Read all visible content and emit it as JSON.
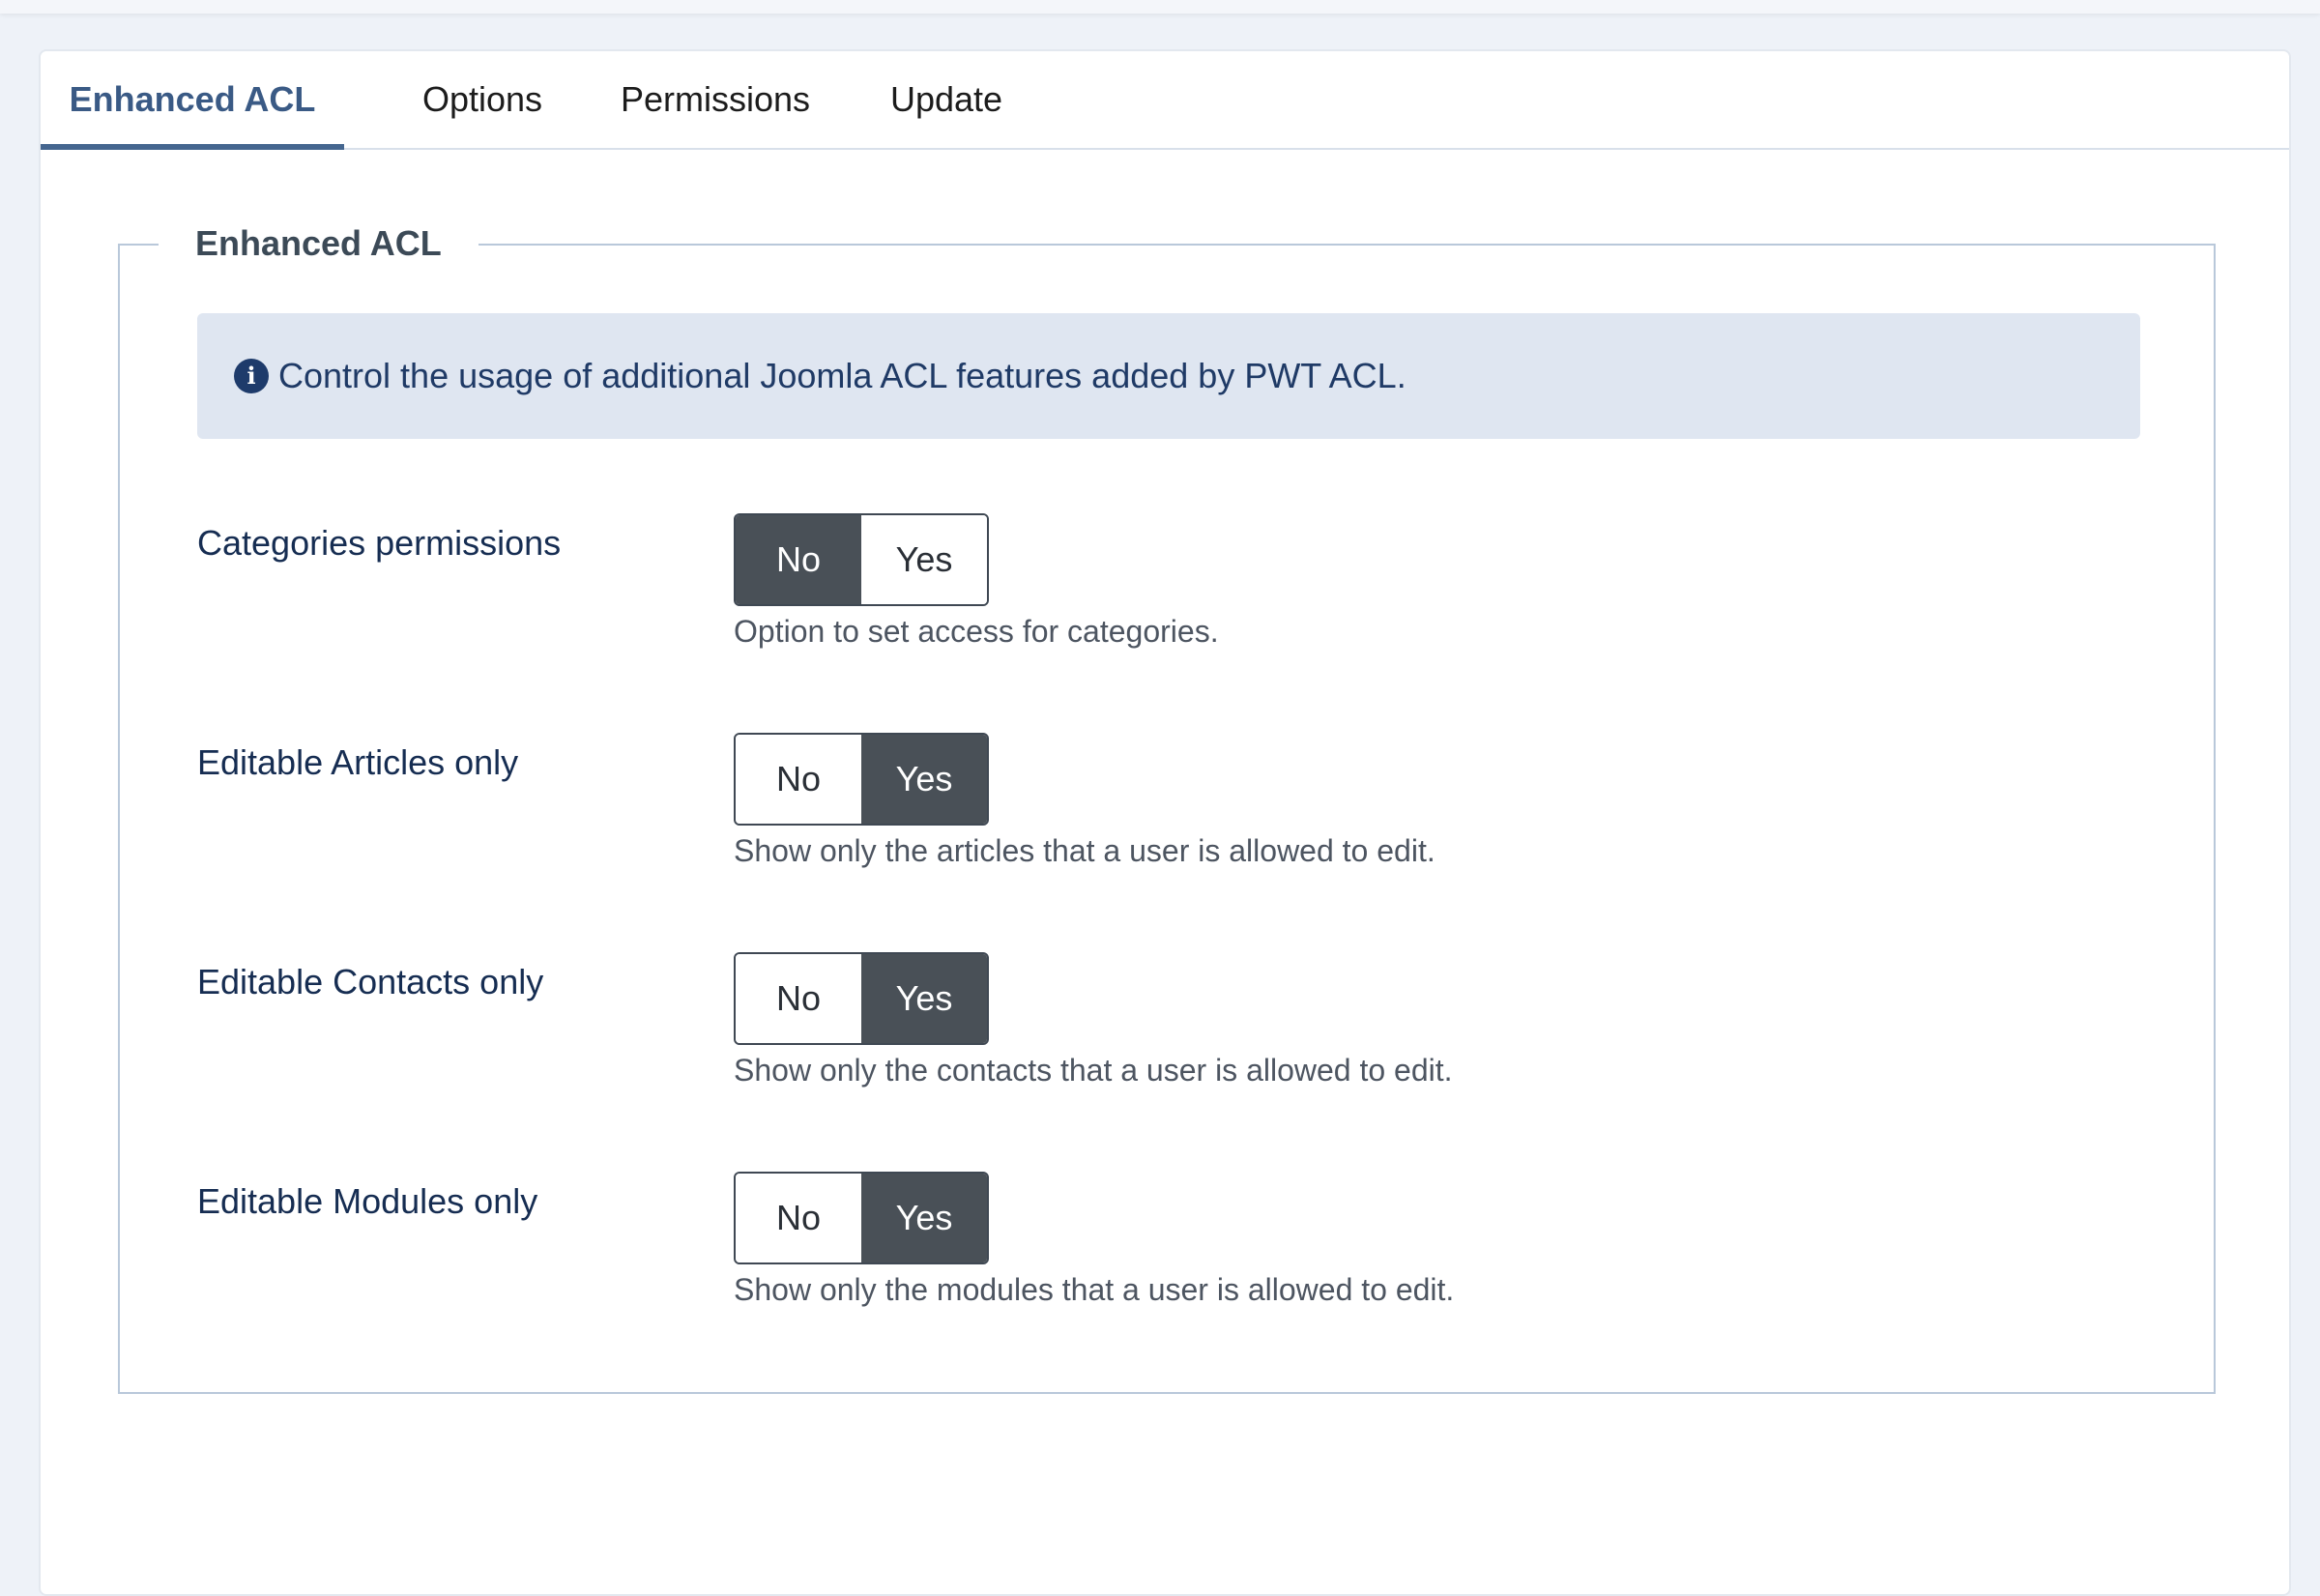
{
  "tabs": [
    {
      "label": "Enhanced ACL",
      "active": true
    },
    {
      "label": "Options",
      "active": false
    },
    {
      "label": "Permissions",
      "active": false
    },
    {
      "label": "Update",
      "active": false
    }
  ],
  "fieldset": {
    "legend": "Enhanced ACL",
    "alert": {
      "icon": "info-icon",
      "text": "Control the usage of additional Joomla ACL features added by PWT ACL."
    },
    "fields": [
      {
        "label": "Categories permissions",
        "options": [
          "No",
          "Yes"
        ],
        "selected": "No",
        "description": "Option to set access for categories."
      },
      {
        "label": "Editable Articles only",
        "options": [
          "No",
          "Yes"
        ],
        "selected": "Yes",
        "description": "Show only the articles that a user is allowed to edit."
      },
      {
        "label": "Editable Contacts only",
        "options": [
          "No",
          "Yes"
        ],
        "selected": "Yes",
        "description": "Show only the contacts that a user is allowed to edit."
      },
      {
        "label": "Editable Modules only",
        "options": [
          "No",
          "Yes"
        ],
        "selected": "Yes",
        "description": "Show only the modules that a user is allowed to edit."
      }
    ]
  },
  "colors": {
    "tab_active": "#3a5a85",
    "switch_selected_bg": "#495057",
    "alert_bg": "#dfe6f1"
  }
}
